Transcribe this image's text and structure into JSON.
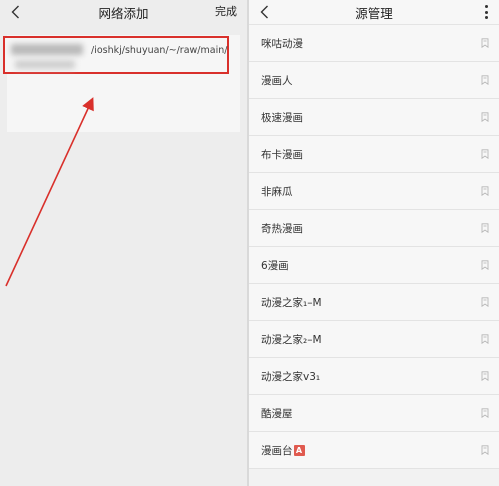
{
  "left": {
    "title": "网络添加",
    "done_label": "完成",
    "url_text": "/ioshkj/shuyuan/~/raw/main/",
    "url_line2": "..."
  },
  "right": {
    "title": "源管理",
    "sources": [
      {
        "label": "咪咕动漫"
      },
      {
        "label": "漫画人"
      },
      {
        "label": "极速漫画"
      },
      {
        "label": "布卡漫画"
      },
      {
        "label": "非麻瓜"
      },
      {
        "label": "奇热漫画"
      },
      {
        "label": "6漫画"
      },
      {
        "label": "动漫之家₁–M"
      },
      {
        "label": "动漫之家₂–M"
      },
      {
        "label": "动漫之家v3₁"
      },
      {
        "label": "酷漫屋"
      },
      {
        "label": "漫画台",
        "badge": "A"
      }
    ]
  },
  "colors": {
    "highlight_red": "#d9302b",
    "badge_red": "#e05a4f"
  }
}
